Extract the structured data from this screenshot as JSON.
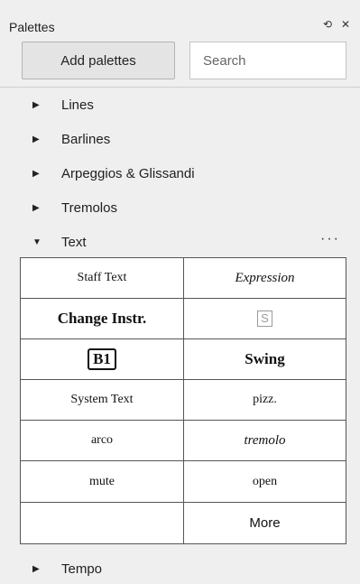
{
  "header": {
    "title": "Palettes",
    "icons": [
      "undock-icon",
      "close-icon"
    ]
  },
  "toolbar": {
    "add_label": "Add palettes",
    "search_placeholder": "Search"
  },
  "groups": [
    {
      "label": "Lines",
      "expanded": false
    },
    {
      "label": "Barlines",
      "expanded": false
    },
    {
      "label": "Arpeggios & Glissandi",
      "expanded": false
    },
    {
      "label": "Tremolos",
      "expanded": false
    },
    {
      "label": "Text",
      "expanded": true
    },
    {
      "label": "Tempo",
      "expanded": false
    }
  ],
  "text_palette": {
    "cells": [
      {
        "label": "Staff Text",
        "style": "serif"
      },
      {
        "label": "Expression",
        "style": "italic"
      },
      {
        "label": "Change Instr.",
        "style": "bold"
      },
      {
        "label": "S",
        "style": "boxed-s"
      },
      {
        "label": "B1",
        "style": "boxed-b"
      },
      {
        "label": "Swing",
        "style": "bold"
      },
      {
        "label": "System Text",
        "style": "serif"
      },
      {
        "label": "pizz.",
        "style": "serif"
      },
      {
        "label": "arco",
        "style": "serif"
      },
      {
        "label": "tremolo",
        "style": "italic"
      },
      {
        "label": "mute",
        "style": "serif"
      },
      {
        "label": "open",
        "style": "serif"
      },
      {
        "label": "",
        "style": "empty"
      },
      {
        "label": "More",
        "style": "sans"
      }
    ]
  }
}
